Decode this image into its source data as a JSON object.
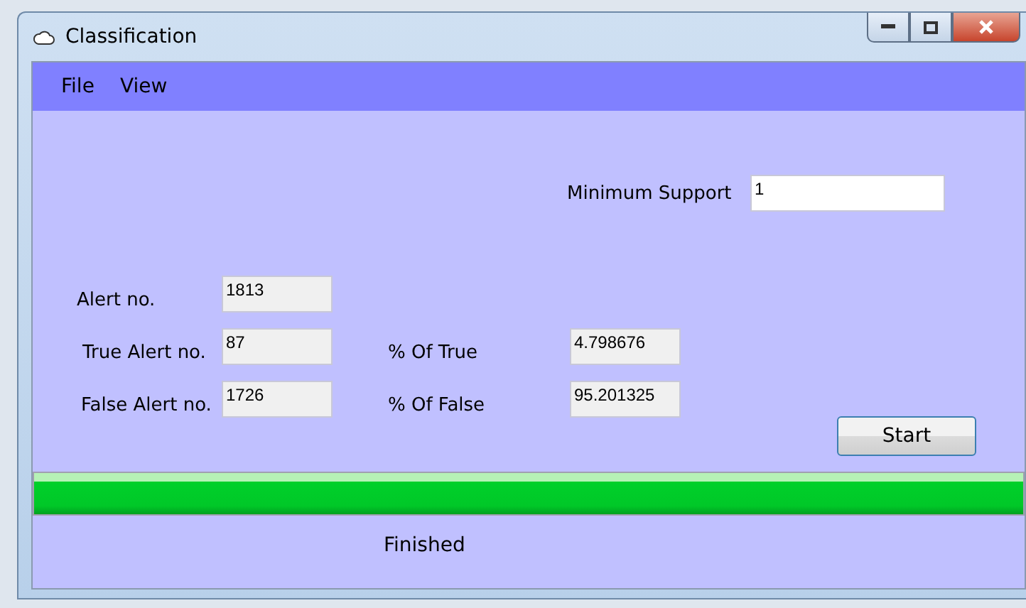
{
  "window": {
    "title": "Classification"
  },
  "menu": [
    {
      "label": "File"
    },
    {
      "label": "View"
    }
  ],
  "minimum_support": {
    "label": "Minimum Support",
    "value": "1"
  },
  "rows": [
    {
      "label": "Alert no.",
      "value": "1813"
    },
    {
      "label": "True Alert no.",
      "value": "87",
      "percent_label": "% Of True",
      "percent_value": "4.798676"
    },
    {
      "label": "False Alert no.",
      "value": "1726",
      "percent_label": "% Of False",
      "percent_value": "95.201325"
    }
  ],
  "start_button": "Start",
  "progress": {
    "level": 1
  },
  "status": "Finished"
}
